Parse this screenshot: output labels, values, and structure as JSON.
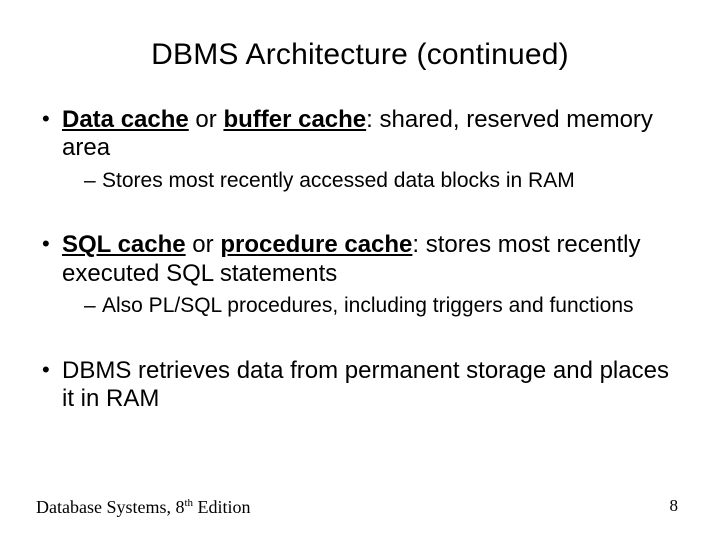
{
  "title": "DBMS Architecture (continued)",
  "bullets": {
    "b1": {
      "bold1": "Data cache",
      "mid": " or ",
      "bold2": "buffer cache",
      "rest": ": shared, reserved memory area",
      "sub1": "Stores most recently accessed data blocks in RAM"
    },
    "b2": {
      "bold1": "SQL cache",
      "mid": " or ",
      "bold2": "procedure cache",
      "rest": ": stores most recently executed SQL statements",
      "sub1": "Also PL/SQL procedures, including triggers and functions"
    },
    "b3": {
      "text": "DBMS retrieves data from permanent storage and places it in RAM"
    }
  },
  "footer": {
    "book": "Database Systems, 8",
    "ord": "th",
    "edition": " Edition",
    "page": "8"
  }
}
